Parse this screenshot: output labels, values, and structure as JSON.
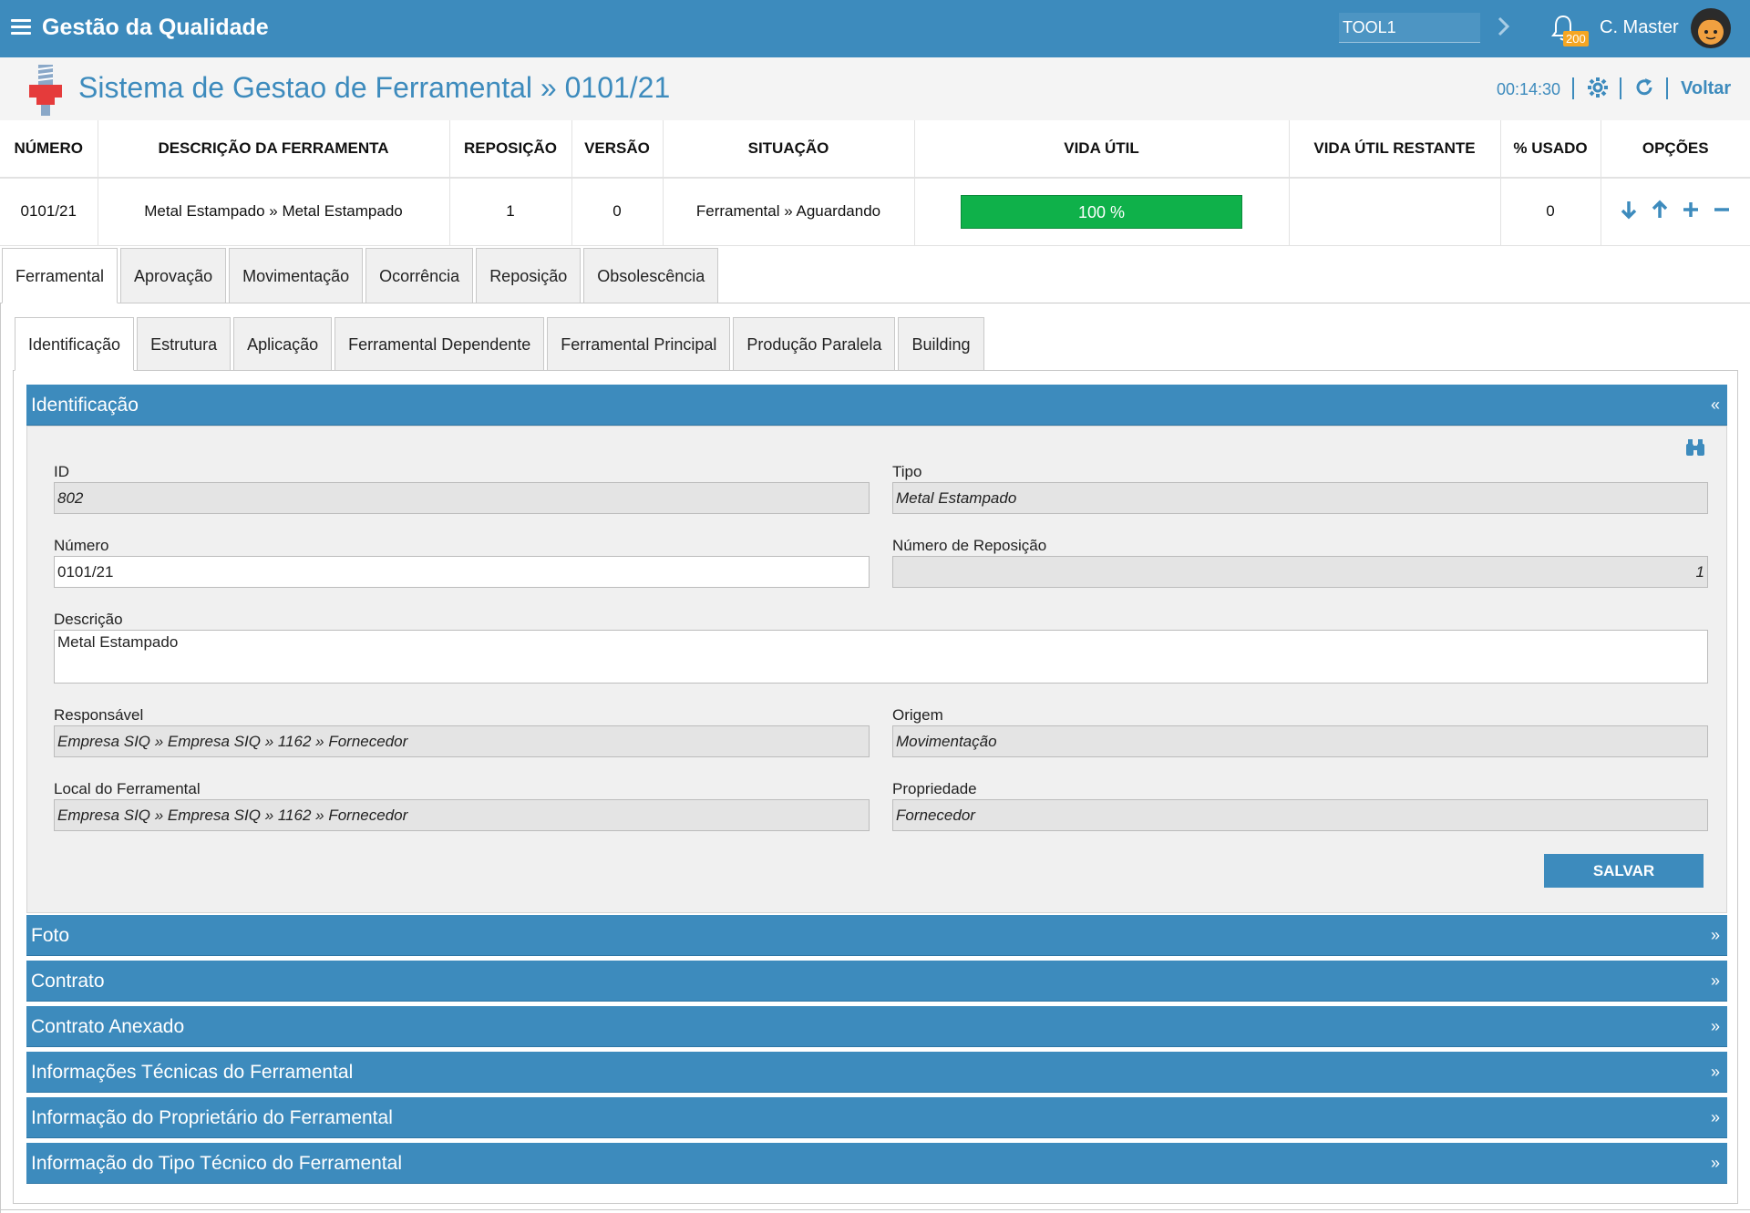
{
  "topbar": {
    "app_title": "Gestão da Qualidade",
    "tool_field_value": "TOOL1",
    "notification_count": "200",
    "user_name": "C. Master"
  },
  "page": {
    "title": "Sistema de Gestao de Ferramental » 0101/21",
    "clock": "00:14:30",
    "back_label": "Voltar"
  },
  "summary": {
    "headers": [
      "NÚMERO",
      "DESCRIÇÃO DA FERRAMENTA",
      "REPOSIÇÃO",
      "VERSÃO",
      "SITUAÇÃO",
      "VIDA ÚTIL",
      "VIDA ÚTIL RESTANTE",
      "% USADO",
      "OPÇÕES"
    ],
    "row": {
      "numero": "0101/21",
      "descricao": "Metal Estampado » Metal Estampado",
      "reposicao": "1",
      "versao": "0",
      "situacao": "Ferramental » Aguardando",
      "vida_util": "100 %",
      "vida_util_fraction": 1.0,
      "vida_util_restante": "",
      "usado": "0"
    },
    "life_bar_color": "#0fb14a"
  },
  "main_tabs": [
    "Ferramental",
    "Aprovação",
    "Movimentação",
    "Ocorrência",
    "Reposição",
    "Obsolescência"
  ],
  "sub_tabs": [
    "Identificação",
    "Estrutura",
    "Aplicação",
    "Ferramental Dependente",
    "Ferramental Principal",
    "Produção Paralela",
    "Building"
  ],
  "identificacao": {
    "header": "Identificação",
    "collapse_glyph": "«",
    "fields": {
      "id_label": "ID",
      "id_value": "802",
      "tipo_label": "Tipo",
      "tipo_value": "Metal Estampado",
      "numero_label": "Número",
      "numero_value": "0101/21",
      "num_reposicao_label": "Número de Reposição",
      "num_reposicao_value": "1",
      "descricao_label": "Descrição",
      "descricao_value": "Metal Estampado",
      "responsavel_label": "Responsável",
      "responsavel_value": "Empresa SIQ » Empresa SIQ » 1162 » Fornecedor",
      "origem_label": "Origem",
      "origem_value": "Movimentação",
      "local_label": "Local do Ferramental",
      "local_value": "Empresa SIQ » Empresa SIQ » 1162 » Fornecedor",
      "propriedade_label": "Propriedade",
      "propriedade_value": "Fornecedor"
    },
    "save_label": "SALVAR"
  },
  "sections": [
    {
      "title": "Foto",
      "glyph": "»"
    },
    {
      "title": "Contrato",
      "glyph": "»"
    },
    {
      "title": "Contrato Anexado",
      "glyph": "»"
    },
    {
      "title": "Informações Técnicas do Ferramental",
      "glyph": "»"
    },
    {
      "title": "Informação do Proprietário do Ferramental",
      "glyph": "»"
    },
    {
      "title": "Informação do Tipo Técnico do Ferramental",
      "glyph": "»"
    }
  ],
  "colors": {
    "primary": "#3d8bbd",
    "success": "#0fb14a",
    "badge": "#f5a623"
  }
}
